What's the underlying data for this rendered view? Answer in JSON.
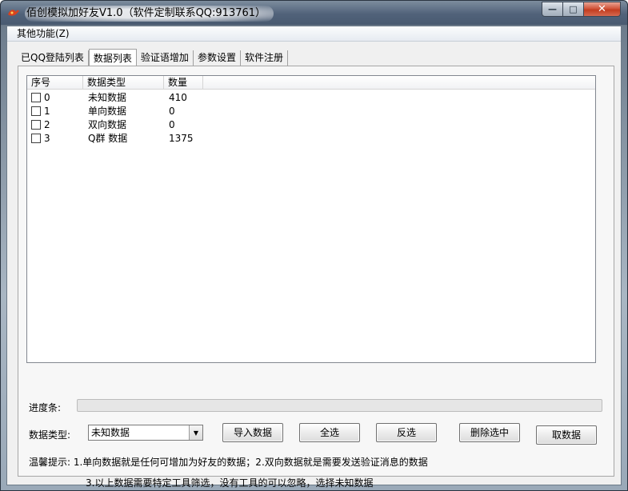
{
  "window": {
    "title": "佰创模拟加好友V1.0（软件定制联系QQ:913761）",
    "controls": {
      "minimize": "—",
      "maximize": "□",
      "close": "✕"
    }
  },
  "menu": {
    "items": [
      {
        "label": "其他功能(Z)"
      }
    ]
  },
  "tabs": [
    {
      "label": "已QQ登陆列表",
      "active": false
    },
    {
      "label": "数据列表",
      "active": true
    },
    {
      "label": "验证语增加",
      "active": false
    },
    {
      "label": "参数设置",
      "active": false
    },
    {
      "label": "软件注册",
      "active": false
    }
  ],
  "list": {
    "columns": [
      "序号",
      "数据类型",
      "数量"
    ],
    "rows": [
      {
        "index": "0",
        "type": "未知数据",
        "count": "410",
        "checked": false
      },
      {
        "index": "1",
        "type": "单向数据",
        "count": "0",
        "checked": false
      },
      {
        "index": "2",
        "type": "双向数据",
        "count": "0",
        "checked": false
      },
      {
        "index": "3",
        "type": "Q群 数据",
        "count": "1375",
        "checked": false
      }
    ]
  },
  "progress": {
    "label": "进度条:",
    "value": 0
  },
  "controls": {
    "type_label": "数据类型:",
    "type_value": "未知数据",
    "import_button": "导入数据",
    "select_all_button": "全选",
    "invert_button": "反选",
    "delete_button": "删除选中",
    "fetch_button": "取数据"
  },
  "hints": {
    "line1": "温馨提示: 1.单向数据就是任何可增加为好友的数据；2.双向数据就是需要发送验证消息的数据",
    "line2": "3.以上数据需要特定工具筛选，没有工具的可以忽略，选择未知数据"
  },
  "colors": {
    "title_bar": "#51627a",
    "close_button": "#c23d20",
    "panel": "#f7f7f7"
  },
  "icons": {
    "app": "app-logo-icon",
    "dropdown": "chevron-down-icon"
  }
}
